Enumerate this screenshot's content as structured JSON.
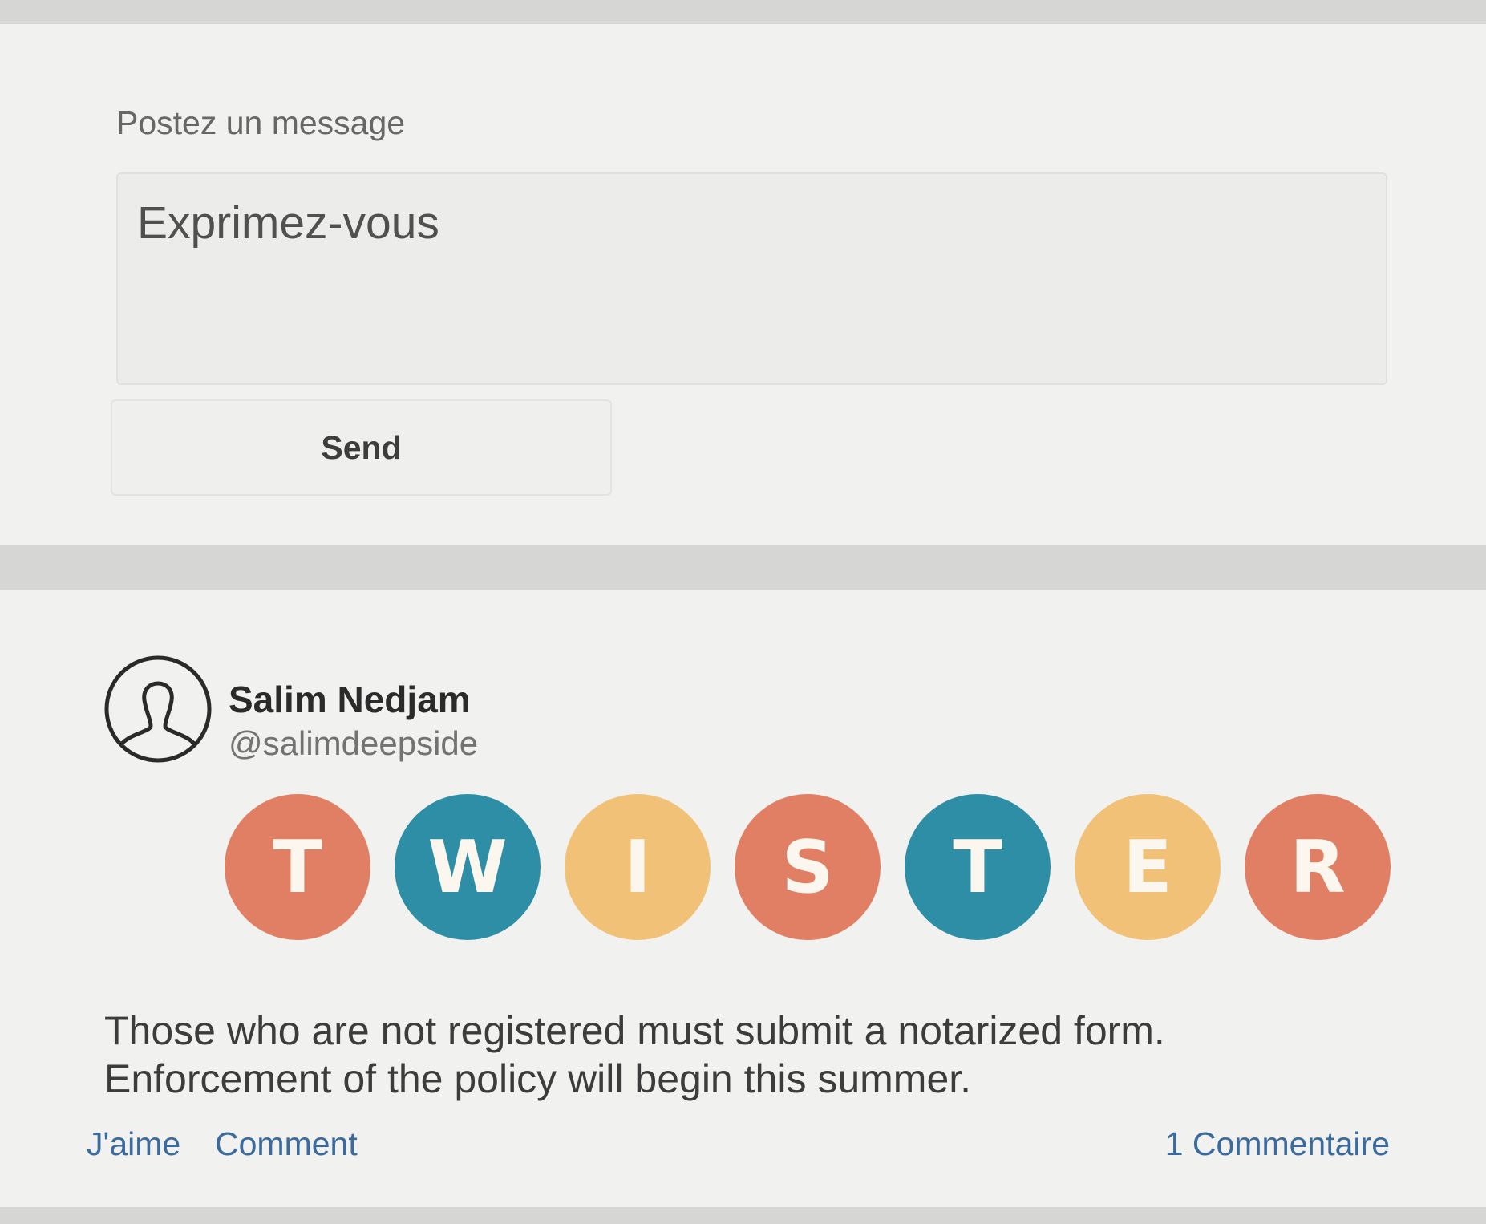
{
  "compose": {
    "title": "Postez un message",
    "placeholder": "Exprimez-vous",
    "send_label": "Send"
  },
  "post": {
    "author_name": "Salim Nedjam",
    "author_handle": "@salimdeepside",
    "logo": {
      "letters": [
        {
          "char": "T",
          "color": "#e07f63"
        },
        {
          "char": "W",
          "color": "#2e8ea5"
        },
        {
          "char": "I",
          "color": "#f1c177"
        },
        {
          "char": "S",
          "color": "#e07f63"
        },
        {
          "char": "T",
          "color": "#2e8ea5"
        },
        {
          "char": "E",
          "color": "#f1c177"
        },
        {
          "char": "R",
          "color": "#e07f63"
        }
      ]
    },
    "text_lines": [
      "Those who are not registered must submit a notarized form.",
      "Enforcement of the policy will begin this summer."
    ],
    "like_label": "J'aime",
    "comment_label": "Comment",
    "comments_count_label": "1 Commentaire"
  },
  "colors": {
    "link": "#3a6a9e",
    "card_background": "#f1f1ef"
  }
}
